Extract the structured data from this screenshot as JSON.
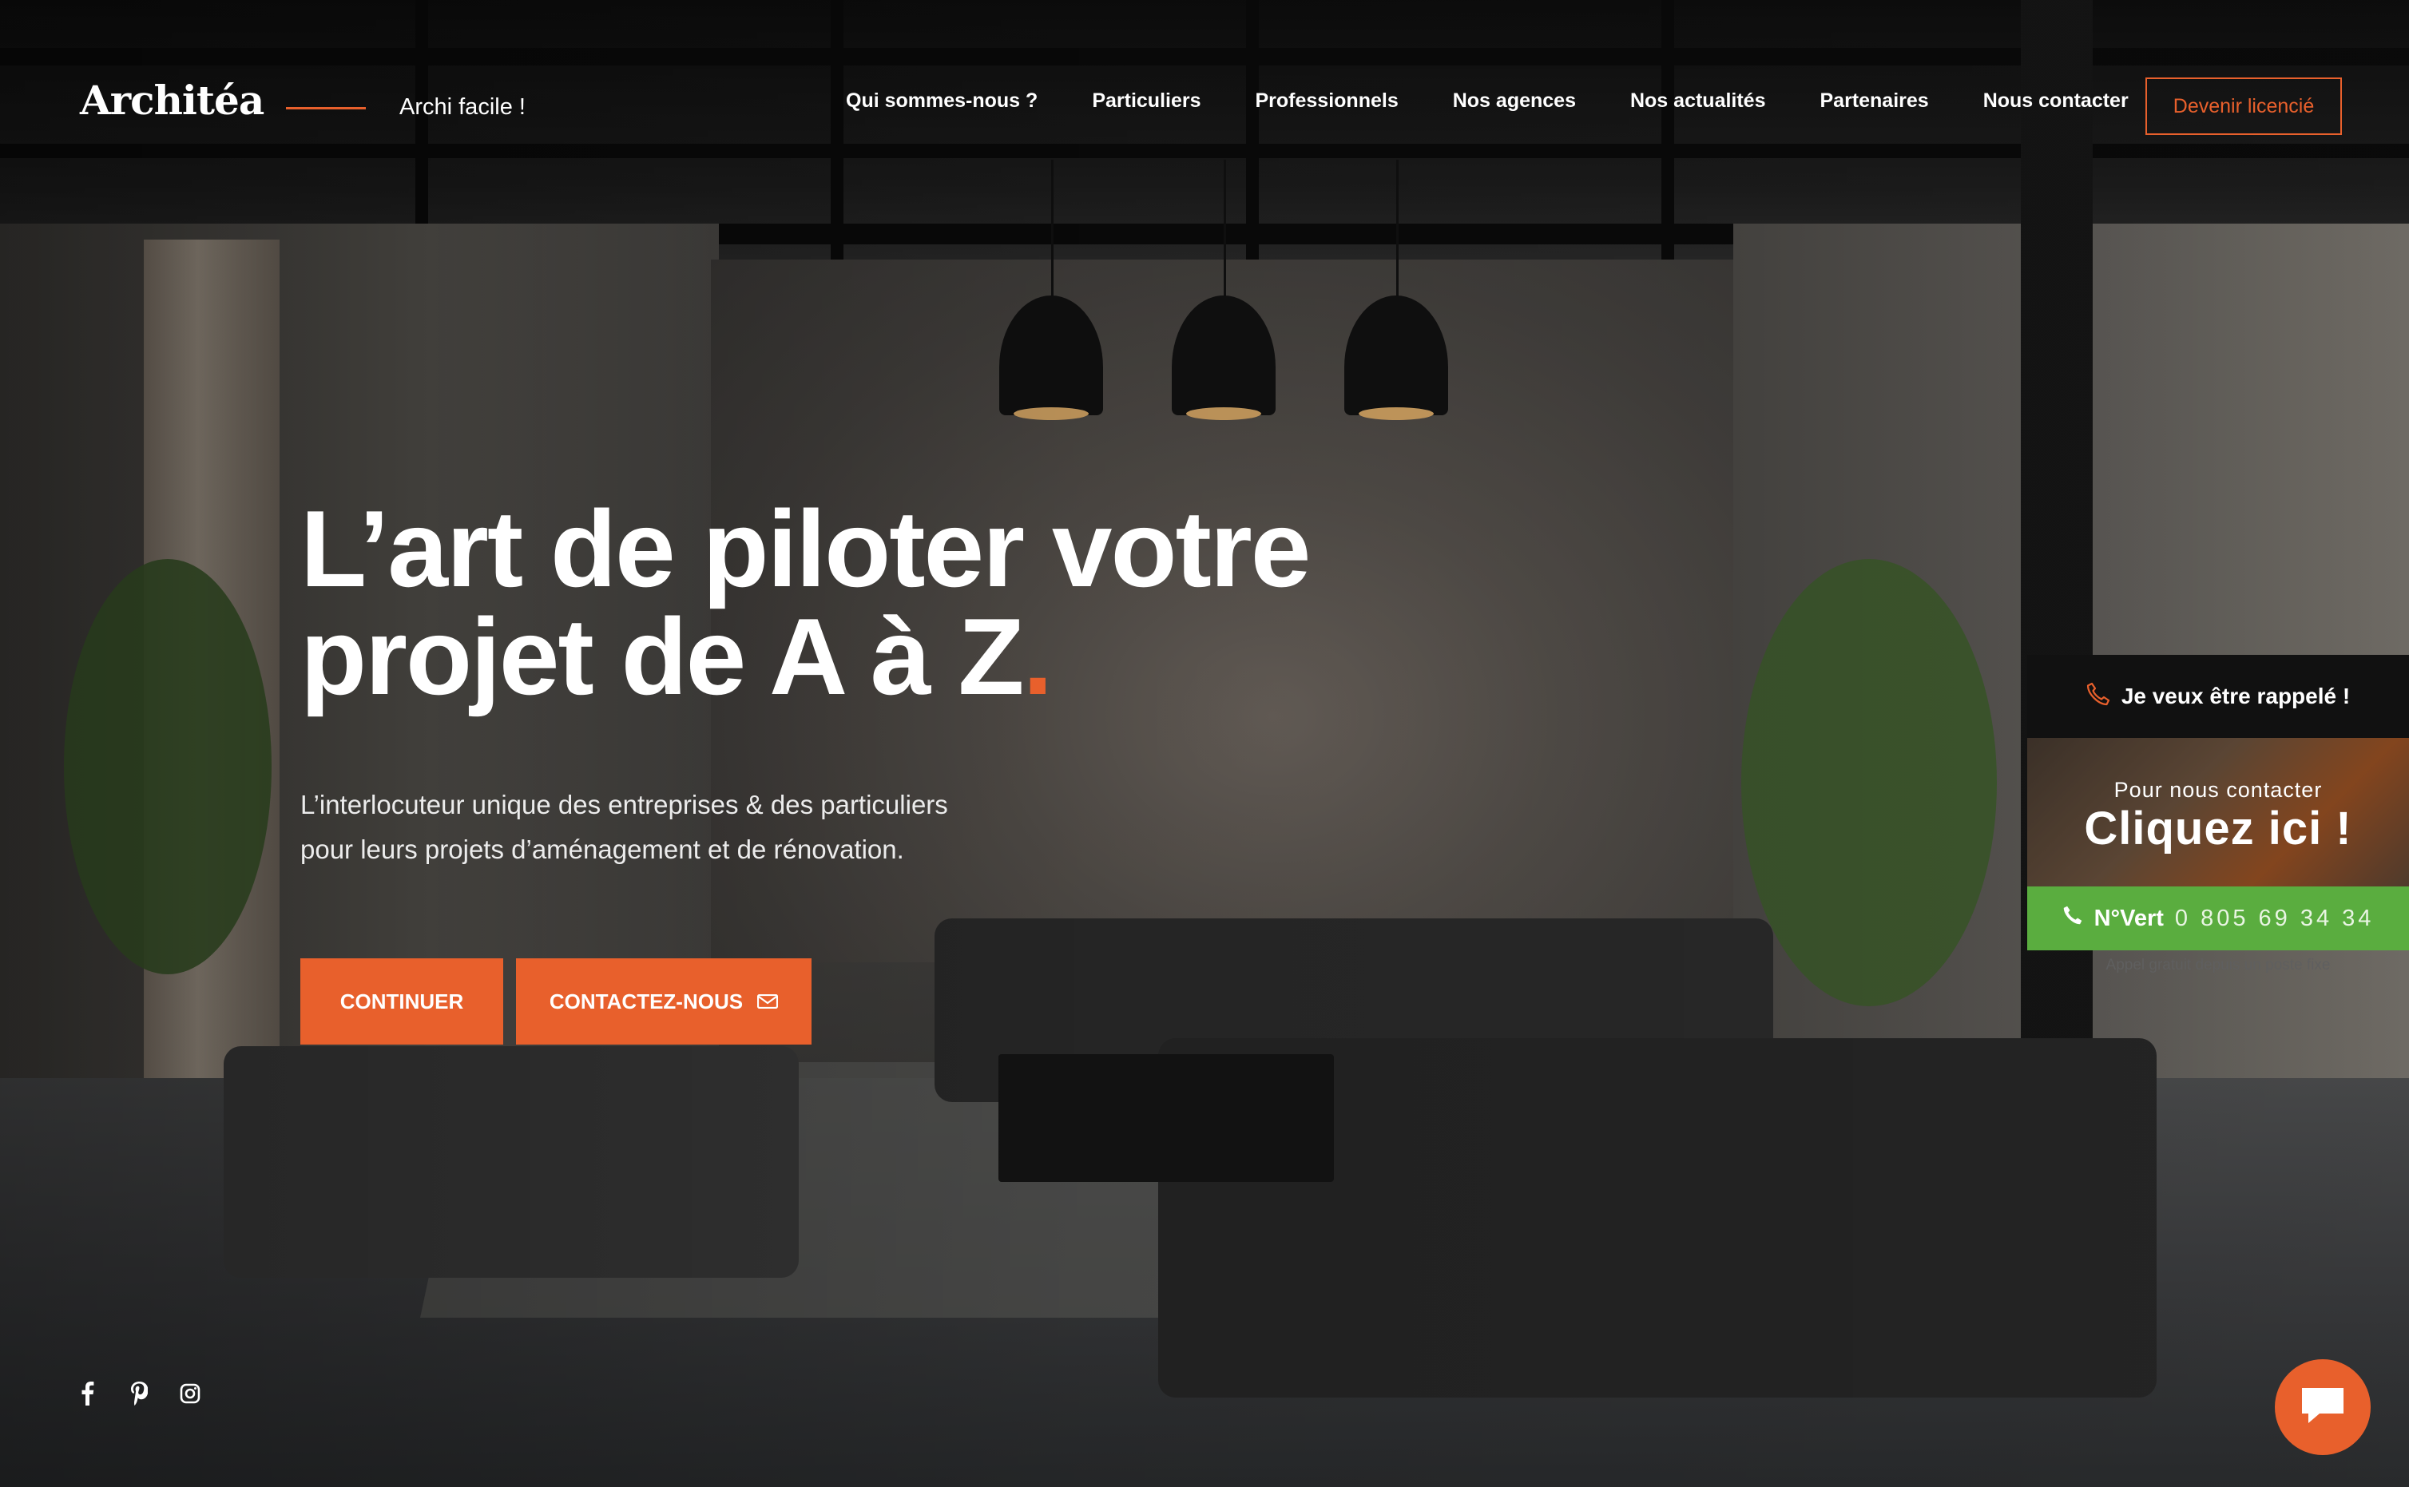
{
  "header": {
    "logo": "Architéa",
    "tagline": "Archi facile !",
    "nav": [
      "Qui sommes-nous ?",
      "Particuliers",
      "Professionnels",
      "Nos agences",
      "Nos actualités",
      "Partenaires",
      "Nous contacter"
    ],
    "cta_label": "Devenir licencié"
  },
  "hero": {
    "title_line1": "L’art de piloter votre",
    "title_line2": "projet de A à Z",
    "title_dot": ".",
    "subtitle_line1": "L’interlocuteur unique des entreprises & des particuliers",
    "subtitle_line2": "pour leurs projets d’aménagement et de rénovation.",
    "btn_continue": "CONTINUER",
    "btn_contact": "CONTACTEZ-NOUS"
  },
  "socials": [
    "facebook-icon",
    "pinterest-icon",
    "instagram-icon"
  ],
  "widget": {
    "callback_label": "Je veux être rappelé !",
    "small_text": "Pour nous contacter",
    "big_text": "Cliquez ici !",
    "phone_label": "N°Vert",
    "phone_number": "0 805 69 34 34",
    "note": "Appel gratuit depuis un poste fixe"
  },
  "colors": {
    "accent": "#e8602c",
    "green": "#5aad3f",
    "dark": "#111111"
  }
}
